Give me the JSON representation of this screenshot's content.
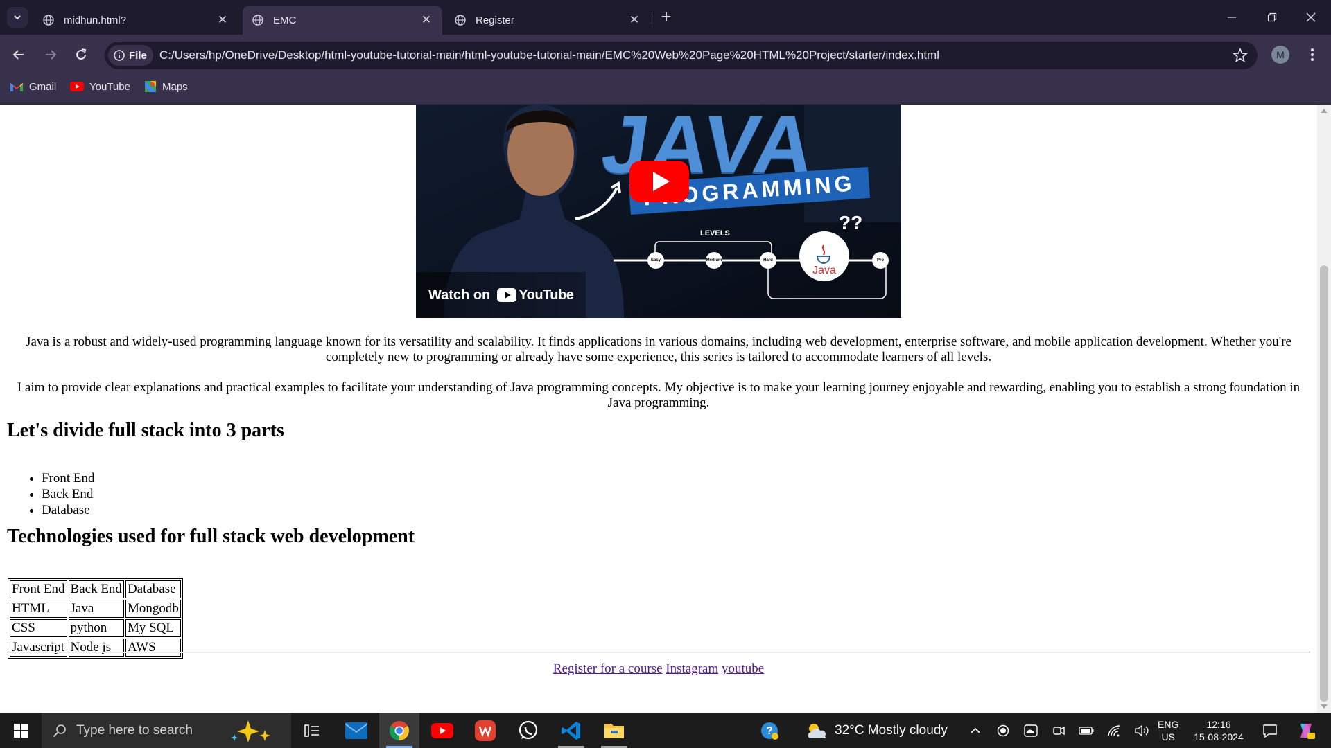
{
  "browser": {
    "tabs": [
      {
        "title": "midhun.html?",
        "active": false
      },
      {
        "title": "EMC",
        "active": true
      },
      {
        "title": "Register",
        "active": false
      }
    ],
    "site_chip": "File",
    "url": "C:/Users/hp/OneDrive/Desktop/html-youtube-tutorial-main/html-youtube-tutorial-main/EMC%20Web%20Page%20HTML%20Project/starter/index.html",
    "profile_initial": "M",
    "bookmarks": [
      {
        "label": "Gmail",
        "icon": "gmail-icon"
      },
      {
        "label": "YouTube",
        "icon": "youtube-icon"
      },
      {
        "label": "Maps",
        "icon": "maps-icon"
      }
    ]
  },
  "video": {
    "headline": "JAVA",
    "banner": "PROGRAMMING",
    "levels_label": "LEVELS",
    "levels": [
      "Easy",
      "Medium",
      "Hard",
      "Pro"
    ],
    "logo_text": "Java",
    "qmarks": "??",
    "watch_on": "Watch on",
    "watch_brand": "YouTube"
  },
  "page": {
    "para1": "Java is a robust and widely-used programming language known for its versatility and scalability. It finds applications in various domains, including web development, enterprise software, and mobile application development. Whether you're completely new to programming or already have some experience, this series is tailored to accommodate learners of all levels.",
    "para2": "I aim to provide clear explanations and practical examples to facilitate your understanding of Java programming concepts. My objective is to make your learning journey enjoyable and rewarding, enabling you to establish a strong foundation in Java programming.",
    "heading1": "Let's divide full stack into 3 parts",
    "parts": [
      "Front End",
      "Back End",
      "Database"
    ],
    "heading2": "Technologies used for full stack web development",
    "table": [
      [
        "Front End",
        "Back End",
        "Database"
      ],
      [
        "HTML",
        "Java",
        "Mongodb"
      ],
      [
        "CSS",
        "python",
        "My SQL"
      ],
      [
        "Javascript",
        "Node js",
        "AWS"
      ]
    ],
    "links": [
      "Register for a course",
      "Instagram",
      "youtube"
    ]
  },
  "taskbar": {
    "search_placeholder": "Type here to search",
    "weather": "32°C  Mostly cloudy",
    "lang_top": "ENG",
    "lang_bottom": "US",
    "time": "12:16",
    "date": "15-08-2024"
  }
}
